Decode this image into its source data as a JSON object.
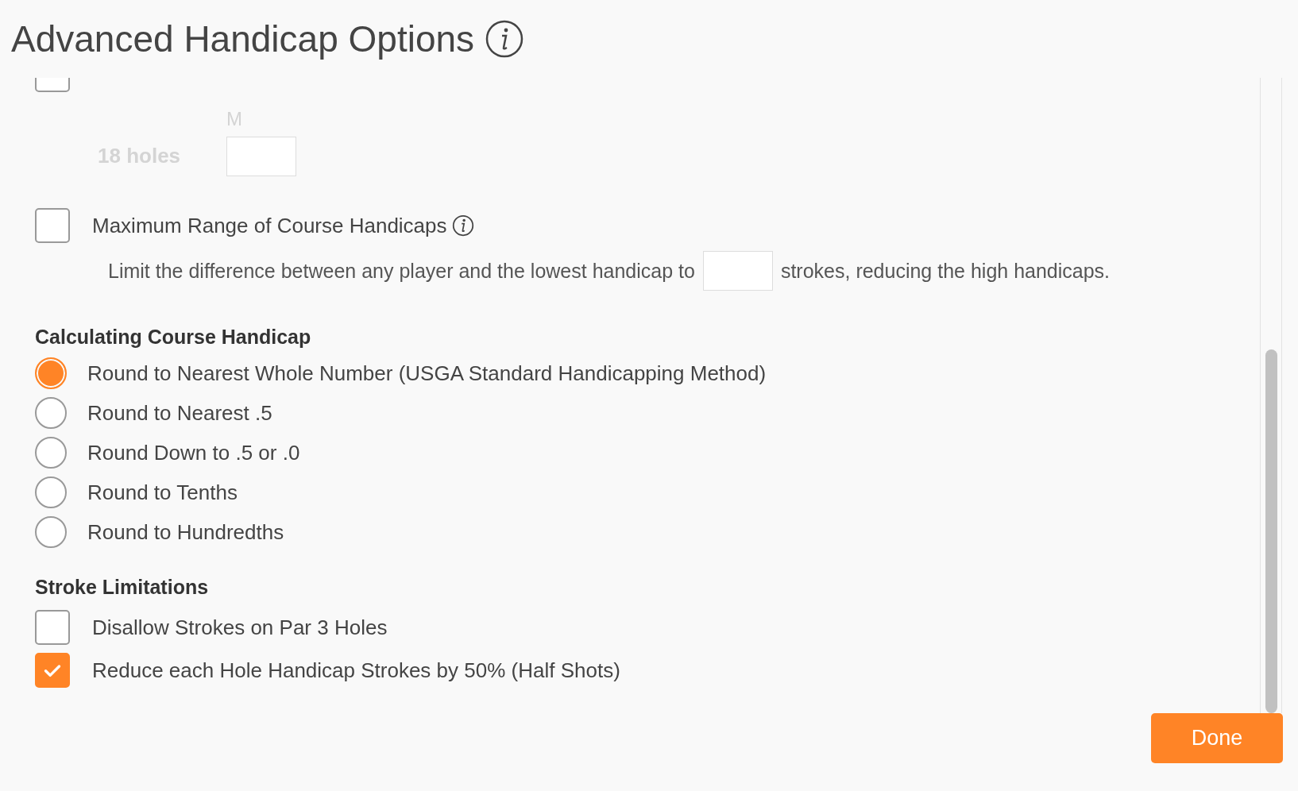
{
  "title": "Advanced Handicap Options",
  "partial_option": {
    "checked": false
  },
  "holes": {
    "label": "18 holes",
    "column": "M",
    "disabled": true
  },
  "max_range": {
    "label": "Maximum Range of Course Handicaps",
    "checked": false,
    "before": "Limit the difference between any player and the lowest handicap to",
    "after": "strokes, reducing the high handicaps."
  },
  "calculating": {
    "heading": "Calculating Course Handicap",
    "options": [
      {
        "label": "Round to Nearest Whole Number (USGA Standard Handicapping Method)",
        "selected": true
      },
      {
        "label": "Round to Nearest .5",
        "selected": false
      },
      {
        "label": "Round Down to .5 or .0",
        "selected": false
      },
      {
        "label": "Round to Tenths",
        "selected": false
      },
      {
        "label": "Round to Hundredths",
        "selected": false
      }
    ]
  },
  "stroke_limitations": {
    "heading": "Stroke Limitations",
    "options": [
      {
        "label": "Disallow Strokes on Par 3 Holes",
        "checked": false
      },
      {
        "label": "Reduce each Hole Handicap Strokes by 50% (Half Shots)",
        "checked": true
      }
    ]
  },
  "done_button": "Done"
}
